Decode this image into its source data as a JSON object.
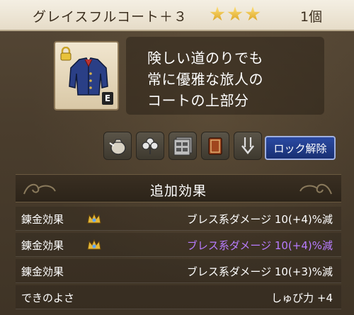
{
  "header": {
    "item_name": "グレイスフルコート＋３",
    "stars": 3,
    "count": "1個"
  },
  "item": {
    "equipped_badge": "E",
    "description": [
      "険しい道のりでも",
      "常に優雅な旅人の",
      "コートの上部分"
    ]
  },
  "actions": {
    "icons": [
      "bag-icon",
      "clover-icon",
      "storage-icon",
      "book-icon",
      "sword-down-icon"
    ],
    "unlock_label": "ロック解除"
  },
  "effects": {
    "section_title": "追加効果",
    "rows": [
      {
        "label": "錬金効果",
        "value": "ブレス系ダメージ 10(+4)%減",
        "crown": true,
        "highlight": false
      },
      {
        "label": "錬金効果",
        "value": "ブレス系ダメージ 10(+4)%減",
        "crown": true,
        "highlight": true
      },
      {
        "label": "錬金効果",
        "value": "ブレス系ダメージ 10(+3)%減",
        "crown": false,
        "highlight": false
      },
      {
        "label": "できのよさ",
        "value": "しゅび力 +4",
        "crown": false,
        "highlight": false
      }
    ]
  },
  "colors": {
    "header_bg": "#f4efe3",
    "accent_button": "#2b4aa3",
    "highlight_text": "#b87cff",
    "star": "#ffd55a"
  }
}
